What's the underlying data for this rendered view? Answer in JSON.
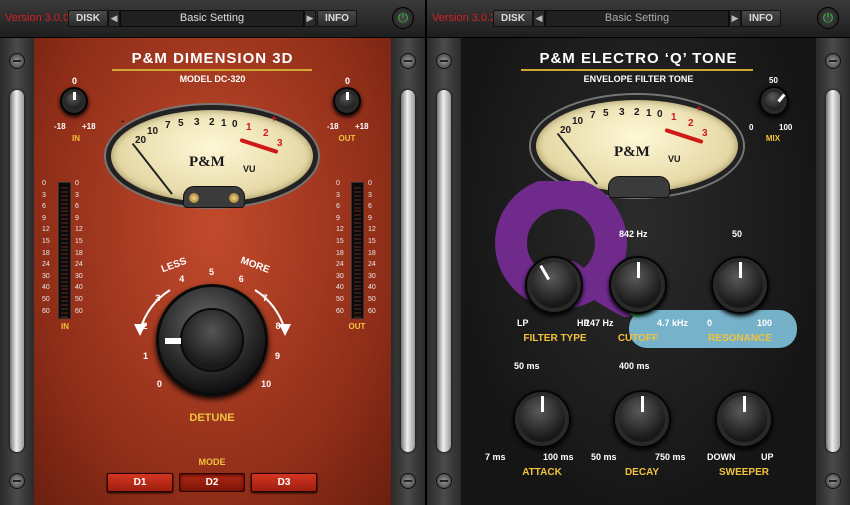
{
  "dimension": {
    "version": "Version 3.0.0",
    "disk_label": "DISK",
    "info_label": "INFO",
    "preset": "Basic Setting",
    "title": "P&M DIMENSION 3D",
    "model": "MODEL DC-320",
    "in_knob": {
      "top": "0",
      "min": "-18",
      "max": "+18",
      "label": "IN"
    },
    "out_knob": {
      "top": "0",
      "min": "-18",
      "max": "+18",
      "label": "OUT"
    },
    "vu": {
      "scale": [
        "20",
        "10",
        "7",
        "5",
        "3",
        "2",
        "1",
        "0"
      ],
      "red_scale": [
        "1",
        "2",
        "3"
      ],
      "minus": "-",
      "plus": "+",
      "logo": "P&M",
      "unit": "VU"
    },
    "meter_scale": [
      "0",
      "3",
      "6",
      "9",
      "12",
      "15",
      "18",
      "24",
      "30",
      "40",
      "50",
      "60"
    ],
    "meter_in_label": "IN",
    "meter_out_label": "OUT",
    "detune": {
      "less": "LESS",
      "more": "MORE",
      "label": "DETUNE",
      "marks": [
        "0",
        "1",
        "2",
        "3",
        "4",
        "5",
        "6",
        "7",
        "8",
        "9",
        "10"
      ]
    },
    "mode_label": "MODE",
    "modes": [
      "D1",
      "D2",
      "D3"
    ],
    "active_mode": "D2"
  },
  "qtone": {
    "version": "Version 3.0.2",
    "disk_label": "DISK",
    "info_label": "INFO",
    "preset": "Basic Setting",
    "title": "P&M ELECTRO ‘Q’ TONE",
    "subtitle": "ENVELOPE FILTER TONE",
    "mix": {
      "top": "50",
      "min": "0",
      "max": "100",
      "label": "MIX"
    },
    "vu": {
      "scale": [
        "20",
        "10",
        "7",
        "5",
        "3",
        "2",
        "1",
        "0"
      ],
      "red_scale": [
        "1",
        "2",
        "3"
      ],
      "minus": "-",
      "plus": "+",
      "logo": "P&M",
      "unit": "VU"
    },
    "filter_type": {
      "left": "LP",
      "right": "HP",
      "label": "FILTER TYPE"
    },
    "cutoff": {
      "top": "842 Hz",
      "left": "147 Hz",
      "right": "4.7 kHz",
      "label": "CUTOFF"
    },
    "resonance": {
      "top": "50",
      "left": "0",
      "right": "100",
      "label": "RESONANCE"
    },
    "attack": {
      "top": "50 ms",
      "left": "7 ms",
      "right": "100 ms",
      "label": "ATTACK"
    },
    "decay": {
      "top": "400 ms",
      "left": "50 ms",
      "right": "750 ms",
      "label": "DECAY"
    },
    "sweeper": {
      "left": "DOWN",
      "right": "UP",
      "label": "SWEEPER"
    }
  },
  "colors": {
    "accent_yellow": "#f1c23c",
    "panel_red": "#a73a20",
    "power_green": "#38c23a",
    "version_red": "#d62020"
  }
}
